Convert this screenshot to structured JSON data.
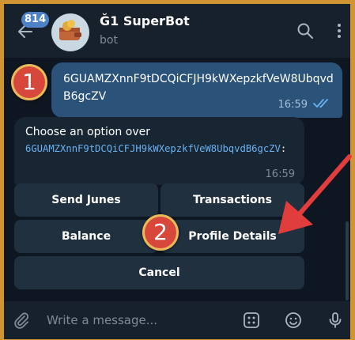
{
  "header": {
    "unread_badge": "814",
    "bot_name": "Ğ1 SuperBot",
    "bot_status": "bot"
  },
  "messages": {
    "outgoing": {
      "text": "6GUAMZXnnF9tDCQiCFJH9kWXepzkfVeW8UbqvdB6gcZV",
      "time": "16:59"
    },
    "incoming": {
      "text": "Choose an option over",
      "link": "6GUAMZXnnF9tDCQiCFJH9kWXepzkfVeW8UbqvdB6gcZV",
      "suffix": ":",
      "time": "16:59"
    }
  },
  "keyboard": {
    "send_junes": "Send Junes",
    "transactions": "Transactions",
    "balance": "Balance",
    "profile_details": "Profile Details",
    "cancel": "Cancel"
  },
  "input": {
    "placeholder": "Write a message..."
  },
  "annotations": {
    "step1": "1",
    "step2": "2",
    "marker_color": "#d8473c",
    "arrow_color": "#e23d3d"
  },
  "colors": {
    "background": "#0e1621",
    "header": "#17212b",
    "outgoing_bubble": "#2b5278",
    "incoming_bubble": "#182533",
    "link": "#6ab2f2",
    "frame": "#d19433"
  }
}
